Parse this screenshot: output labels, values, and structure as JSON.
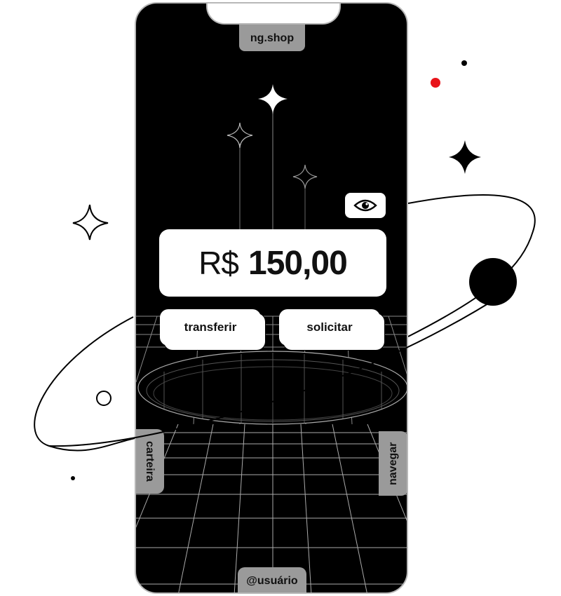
{
  "header": {
    "shop_label": "ng.shop"
  },
  "balance": {
    "currency": "R$",
    "amount": "150,00"
  },
  "actions": {
    "transfer_label": "transferir",
    "request_label": "solicitar"
  },
  "side_nav": {
    "left_label": "carteira",
    "right_label": "navegar"
  },
  "footer": {
    "user_label": "@usuário"
  },
  "icons": {
    "visibility": "eye-icon"
  },
  "colors": {
    "background": "#ffffff",
    "phone": "#000000",
    "pill": "#9a9a9a",
    "accent_dot": "#e8141a"
  }
}
